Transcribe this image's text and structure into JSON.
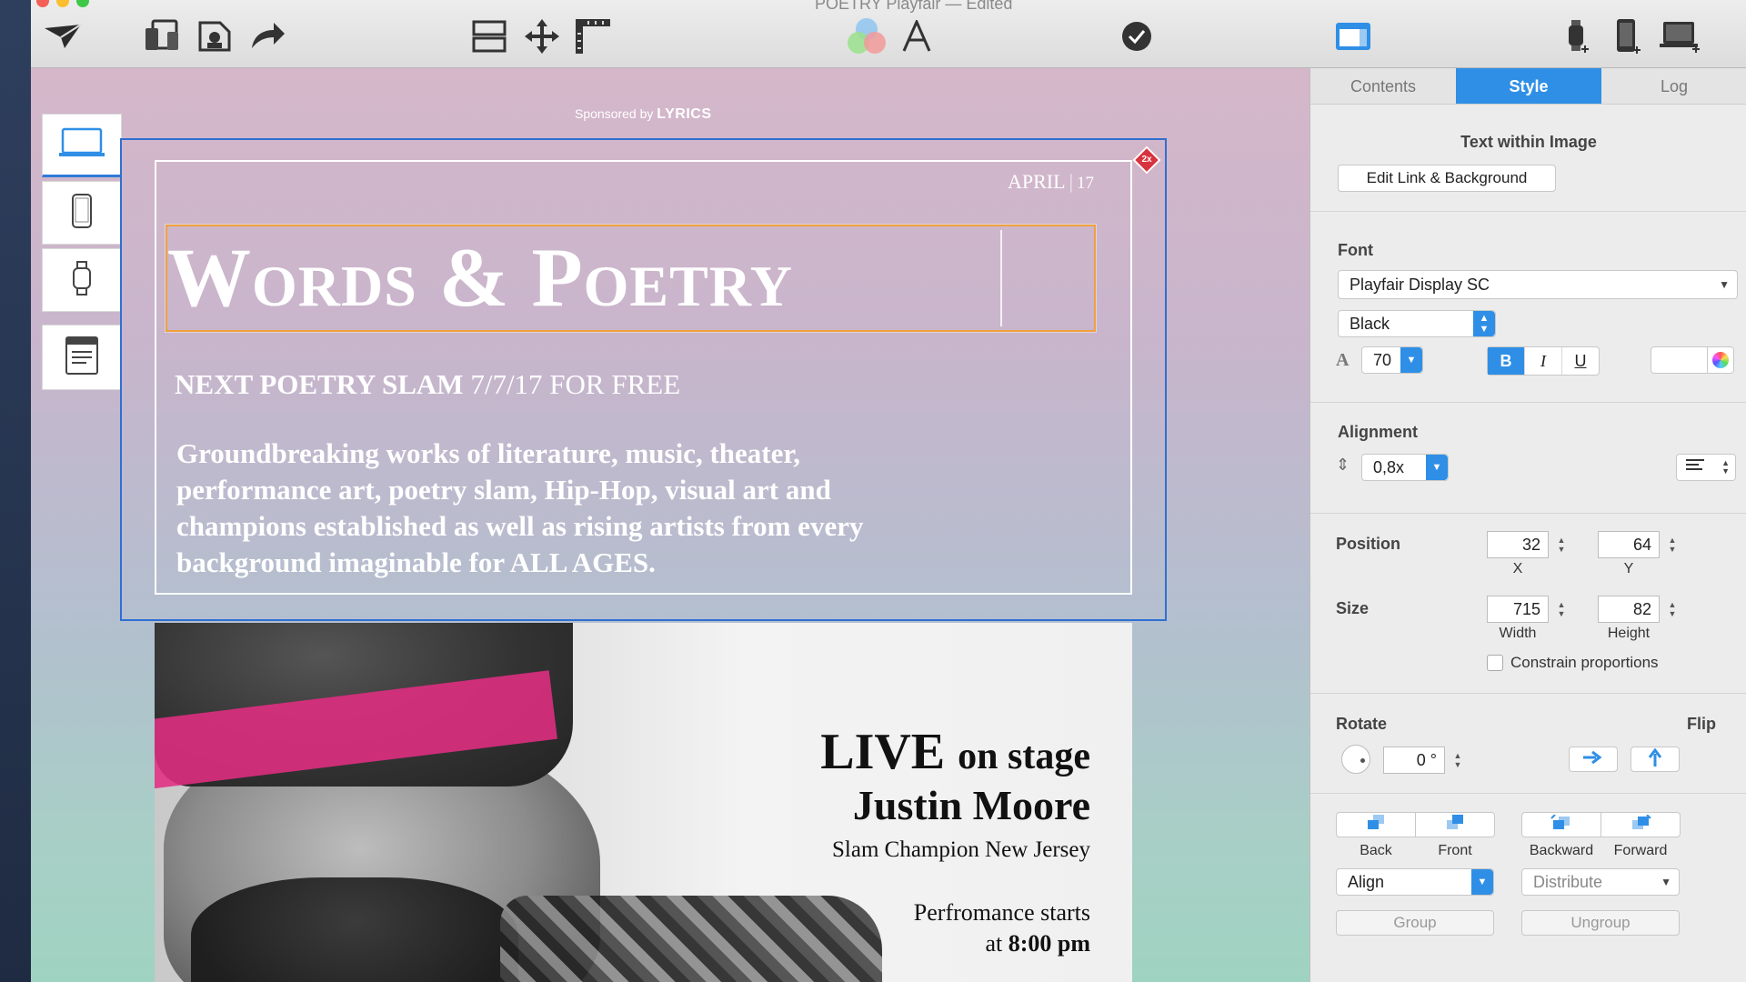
{
  "window": {
    "title": "POETRY Playfair — Edited"
  },
  "colors": {
    "accent": "#2f8fe6",
    "selection": "#2f6fd1",
    "highlight": "#f0a13e",
    "pink_band": "#e12d82"
  },
  "toolbar": {
    "icons": [
      "paper-plane-icon",
      "devices-icon",
      "document-image-icon",
      "share-icon",
      "layout-icon",
      "move-icon",
      "ruler-icon",
      "color-circles-icon",
      "font-icon",
      "checkmark-icon",
      "window-panel-icon",
      "watch-add-icon",
      "phone-add-icon",
      "laptop-add-icon"
    ]
  },
  "poster": {
    "sponsor_prefix": "Sponsored by",
    "sponsor_brand": "LYRICS",
    "date_month": "APRIL",
    "date_day": "17",
    "headline": "Words & Poetry",
    "badge": "2x",
    "next_slam_bold": "NEXT POETRY SLAM",
    "next_slam_rest": "7/7/17 FOR FREE",
    "body": "Groundbreaking works of literature, music, theater, performance art, poetry slam, Hip-Hop, visual art and champions established as well as rising artists from every background imaginable for ALL AGES.",
    "live": "LIVE",
    "live_rest": "on stage",
    "performer": "Justin Moore",
    "performer_sub": "Slam Champion New Jersey",
    "perf_start_line1": "Perfromance starts",
    "perf_start_at": "at",
    "perf_start_time": "8:00 pm"
  },
  "inspector": {
    "tabs": [
      {
        "label": "Contents",
        "active": false
      },
      {
        "label": "Style",
        "active": true
      },
      {
        "label": "Log",
        "active": false
      }
    ],
    "text_within_image": {
      "heading": "Text within Image",
      "edit_button": "Edit Link & Background"
    },
    "font": {
      "label": "Font",
      "family": "Playfair Display SC",
      "weight": "Black",
      "size": "70",
      "bold": "B",
      "italic": "I",
      "underline": "U"
    },
    "alignment": {
      "label": "Alignment",
      "line_height": "0,8x"
    },
    "position": {
      "label": "Position",
      "x": "32",
      "y": "64",
      "x_label": "X",
      "y_label": "Y"
    },
    "size": {
      "label": "Size",
      "width": "715",
      "height": "82",
      "width_label": "Width",
      "height_label": "Height",
      "constrain": "Constrain proportions"
    },
    "rotate": {
      "label": "Rotate",
      "value": "0 °",
      "flip_label": "Flip"
    },
    "arrange": {
      "back": "Back",
      "front": "Front",
      "backward": "Backward",
      "forward": "Forward",
      "align": "Align",
      "distribute": "Distribute",
      "group": "Group",
      "ungroup": "Ungroup"
    }
  }
}
